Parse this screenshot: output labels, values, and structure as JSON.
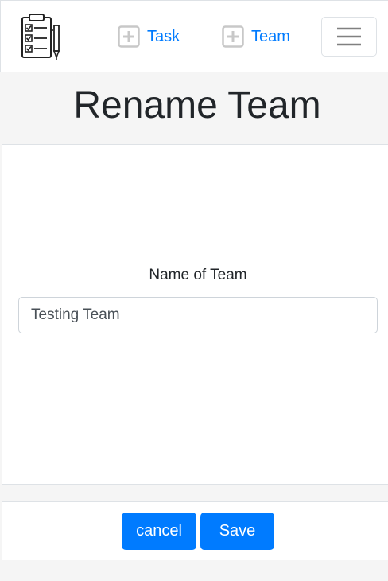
{
  "app": {
    "logo_icon": "clipboard-checklist-icon"
  },
  "nav": {
    "task_label": "Task",
    "team_label": "Team",
    "add_icon": "plus-square-icon",
    "menu_icon": "hamburger-menu-icon"
  },
  "page": {
    "title": "Rename Team"
  },
  "form": {
    "name_label": "Name of Team",
    "name_value": "Testing Team"
  },
  "footer": {
    "cancel_label": "cancel",
    "save_label": "Save"
  },
  "colors": {
    "primary": "#007bff",
    "page_background": "#f5f5f5",
    "text": "#212529"
  }
}
